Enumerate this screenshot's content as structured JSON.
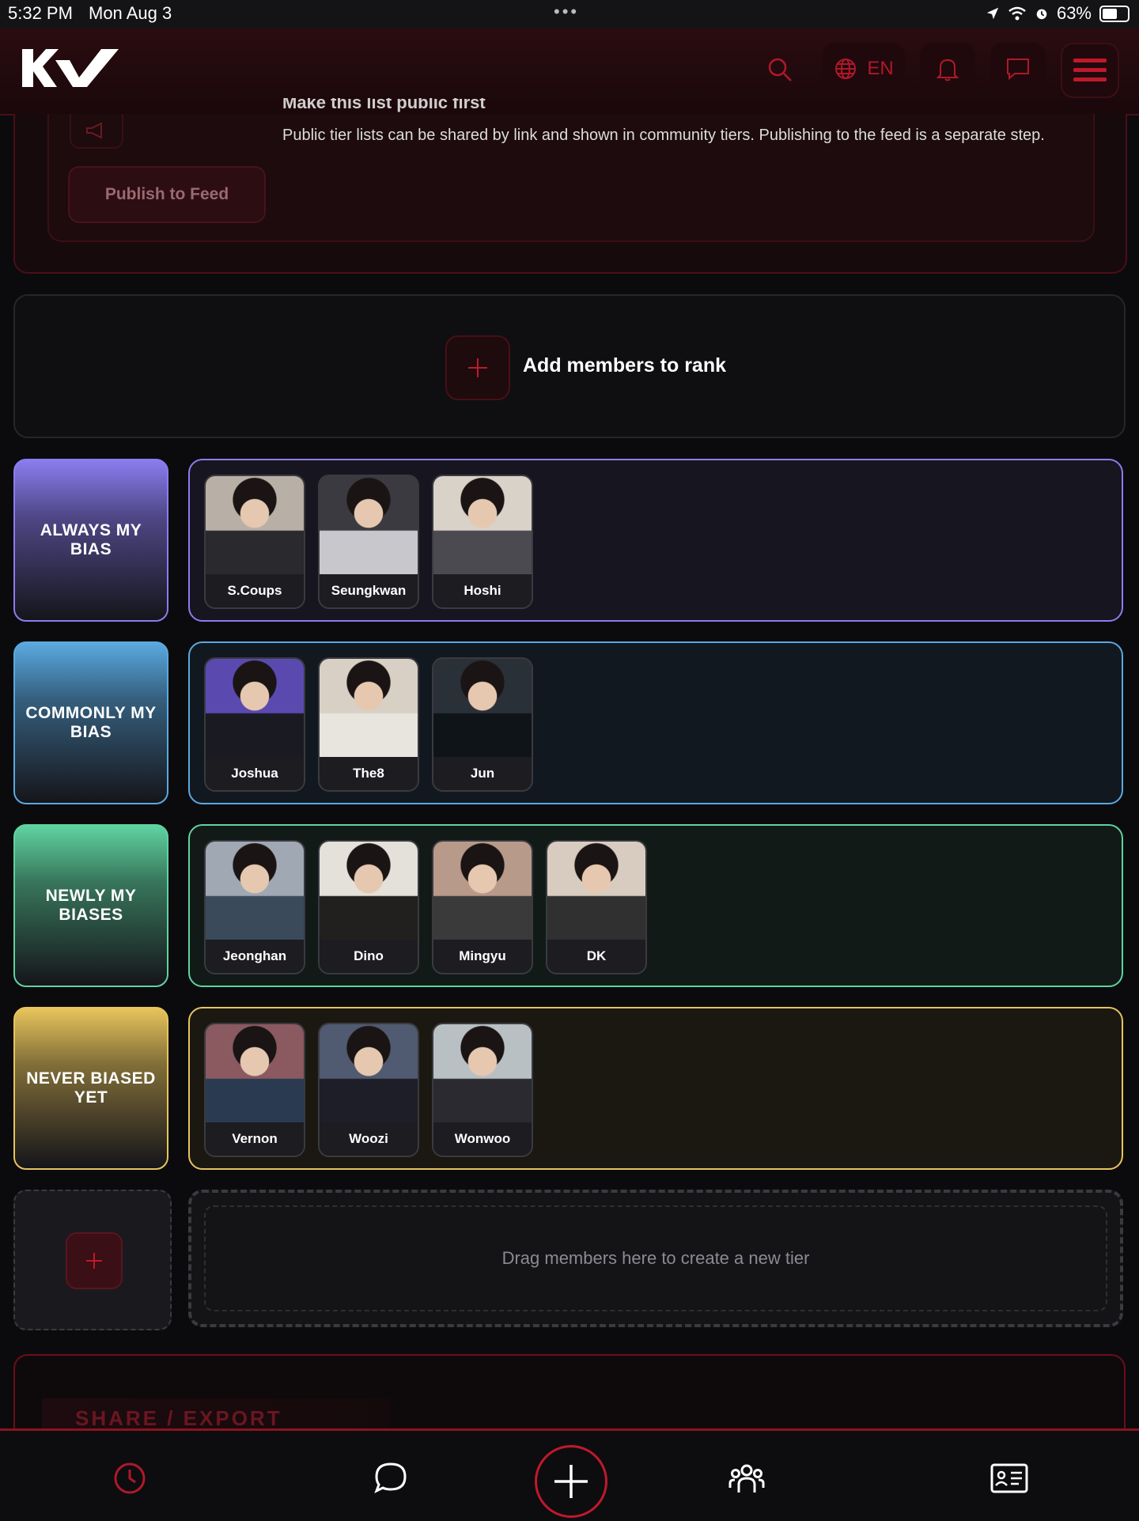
{
  "status": {
    "time": "5:32 PM",
    "date": "Mon Aug 3",
    "dots": "•••",
    "battery": "63%"
  },
  "header": {
    "logo": "KV",
    "language": "EN"
  },
  "publish": {
    "title_partial": "Make this list public first",
    "description": "Public tier lists can be shared by link and shown in community tiers. Publishing to the feed is a separate step.",
    "button_label": "Publish to Feed"
  },
  "add_members": {
    "label": "Add members to rank"
  },
  "tiers": [
    {
      "label": "ALWAYS MY BIAS",
      "color": "#8b7cf0",
      "members": [
        {
          "name": "S.Coups"
        },
        {
          "name": "Seungkwan"
        },
        {
          "name": "Hoshi"
        }
      ]
    },
    {
      "label": "COMMONLY MY BIAS",
      "color": "#5aa9e0",
      "members": [
        {
          "name": "Joshua"
        },
        {
          "name": "The8"
        },
        {
          "name": "Jun"
        }
      ]
    },
    {
      "label": "NEWLY MY BIASES",
      "color": "#5fd3a0",
      "members": [
        {
          "name": "Jeonghan"
        },
        {
          "name": "Dino"
        },
        {
          "name": "Mingyu"
        },
        {
          "name": "DK"
        }
      ]
    },
    {
      "label": "NEVER BIASED YET",
      "color": "#e8c45c",
      "members": [
        {
          "name": "Vernon"
        },
        {
          "name": "Woozi"
        },
        {
          "name": "Wonwoo"
        }
      ]
    }
  ],
  "new_tier": {
    "drop_text": "Drag members here to create a new tier"
  },
  "share": {
    "title": "SHARE / EXPORT"
  },
  "colors": {
    "accent": "#c0192b",
    "background": "#0b0b0e"
  },
  "nav_icons": [
    "clock-icon",
    "chat-icon",
    "plus-icon",
    "group-icon",
    "profile-card-icon"
  ]
}
